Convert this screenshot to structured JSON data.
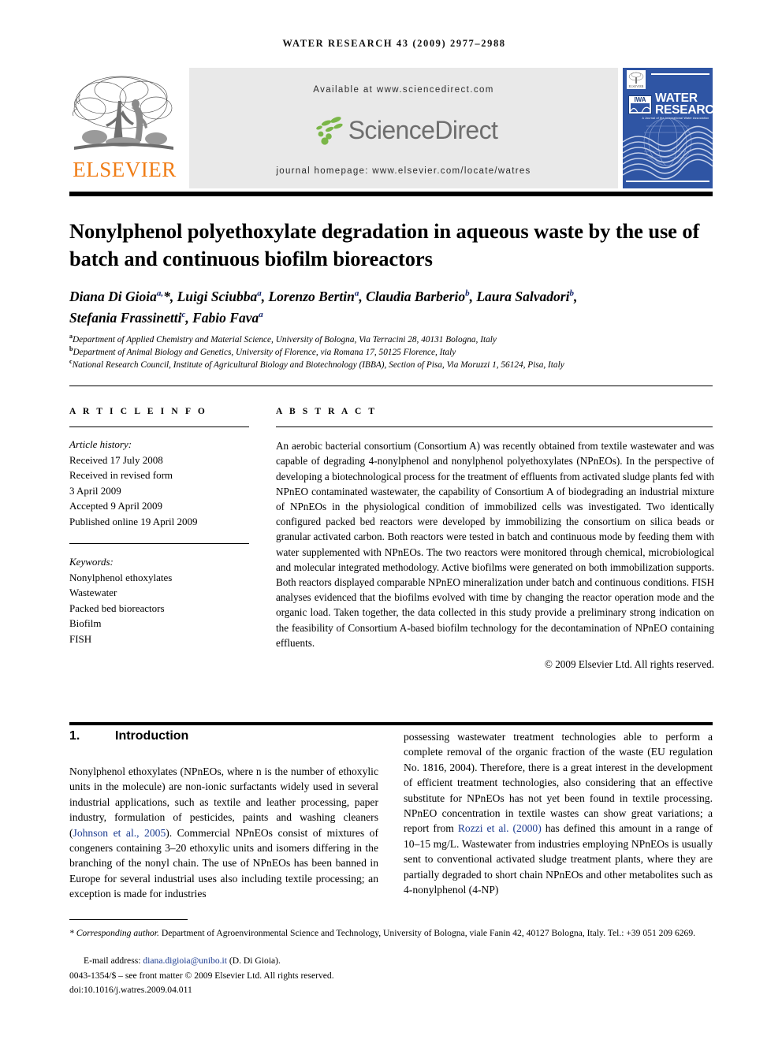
{
  "running_head": "WATER RESEARCH 43 (2009) 2977–2988",
  "masthead": {
    "available_at": "Available at www.sciencedirect.com",
    "sciencedirect_logo_text": "ScienceDirect",
    "journal_homepage": "journal homepage: www.elsevier.com/locate/watres",
    "publisher_name": "ELSEVIER",
    "cover": {
      "title_line1": "WATER",
      "title_line2": "RESEARCH",
      "society_mark": "IWA",
      "tagline": "A Journal of the International Water Association"
    }
  },
  "article": {
    "title": "Nonylphenol polyethoxylate degradation in aqueous waste by the use of batch and continuous biofilm bioreactors",
    "authors_line1_html": "Diana Di Gioia<sup>a,</sup>*, Luigi Sciubba<sup>a</sup>, Lorenzo Bertin<sup>a</sup>, Claudia Barberio<sup>b</sup>, Laura Salvadori<sup>b</sup>,",
    "authors_line2_html": "Stefania Frassinetti<sup>c</sup>, Fabio Fava<sup>a</sup>",
    "affiliations": [
      "Department of Applied Chemistry and Material Science, University of Bologna, Via Terracini 28, 40131 Bologna, Italy",
      "Department of Animal Biology and Genetics, University of Florence, via Romana 17, 50125 Florence, Italy",
      "National Research Council, Institute of Agricultural Biology and Biotechnology (IBBA), Section of Pisa, Via Moruzzi 1, 56124, Pisa, Italy"
    ],
    "affiliation_marks": [
      "a",
      "b",
      "c"
    ]
  },
  "article_info": {
    "heading": "A R T I C L E   I N F O",
    "history_label": "Article history:",
    "history": [
      "Received 17 July 2008",
      "Received in revised form",
      "3 April 2009",
      "Accepted 9 April 2009",
      "Published online 19 April 2009"
    ],
    "keywords_label": "Keywords:",
    "keywords": [
      "Nonylphenol ethoxylates",
      "Wastewater",
      "Packed bed bioreactors",
      "Biofilm",
      "FISH"
    ]
  },
  "abstract": {
    "heading": "A B S T R A C T",
    "text": "An aerobic bacterial consortium (Consortium A) was recently obtained from textile wastewater and was capable of degrading 4-nonylphenol and nonylphenol polyethoxylates (NPnEOs). In the perspective of developing a biotechnological process for the treatment of effluents from activated sludge plants fed with NPnEO contaminated wastewater, the capability of Consortium A of biodegrading an industrial mixture of NPnEOs in the physiological condition of immobilized cells was investigated. Two identically configured packed bed reactors were developed by immobilizing the consortium on silica beads or granular activated carbon. Both reactors were tested in batch and continuous mode by feeding them with water supplemented with NPnEOs. The two reactors were monitored through chemical, microbiological and molecular integrated methodology. Active biofilms were generated on both immobilization supports. Both reactors displayed comparable NPnEO mineralization under batch and continuous conditions. FISH analyses evidenced that the biofilms evolved with time by changing the reactor operation mode and the organic load. Taken together, the data collected in this study provide a preliminary strong indication on the feasibility of Consortium A-based biofilm technology for the decontamination of NPnEO containing effluents.",
    "copyright": "© 2009 Elsevier Ltd. All rights reserved."
  },
  "body": {
    "section_number": "1.",
    "section_title": "Introduction",
    "left_column_html": "Nonylphenol ethoxylates (NPnEOs, where n is the number of ethoxylic units in the molecule) are non-ionic surfactants widely used in several industrial applications, such as textile and leather processing, paper industry, formulation of pesticides, paints and washing cleaners (<span class=\"ref-link\">Johnson et al., 2005</span>). Commercial NPnEOs consist of mixtures of congeners containing 3–20 ethoxylic units and isomers differing in the branching of the nonyl chain. The use of NPnEOs has been banned in Europe for several industrial uses also including textile processing; an exception is made for industries",
    "right_column_html": "possessing wastewater treatment technologies able to perform a complete removal of the organic fraction of the waste (EU regulation No. 1816, 2004). Therefore, there is a great interest in the development of efficient treatment technologies, also considering that an effective substitute for NPnEOs has not yet been found in textile processing. NPnEO concentration in textile wastes can show great variations; a report from <span class=\"ref-link\">Rozzi et al. (2000)</span> has defined this amount in a range of 10–15 mg/L. Wastewater from industries employing NPnEOs is usually sent to conventional activated sludge treatment plants, where they are partially degraded to short chain NPnEOs and other metabolites such as 4-nonylphenol (4-NP)"
  },
  "footer": {
    "corresponding_html": "<span class=\"corr\">* Corresponding author.</span> Department of Agroenvironmental Science and Technology, University of Bologna, viale Fanin 42, 40127 Bologna, Italy. Tel.: +39 051 209 6269.",
    "email_label": "E-mail address:",
    "email": "diana.digioia@unibo.it",
    "email_owner": "(D. Di Gioia).",
    "issn_line": "0043-1354/$ – see front matter © 2009 Elsevier Ltd. All rights reserved.",
    "doi_line": "doi:10.1016/j.watres.2009.04.011"
  },
  "colors": {
    "elsevier_orange": "#f07d16",
    "cover_blue": "#2f55a4",
    "link_blue": "#1a3a8f",
    "superscript_blue": "#14246b",
    "masthead_gray": "#e9e9e9"
  }
}
